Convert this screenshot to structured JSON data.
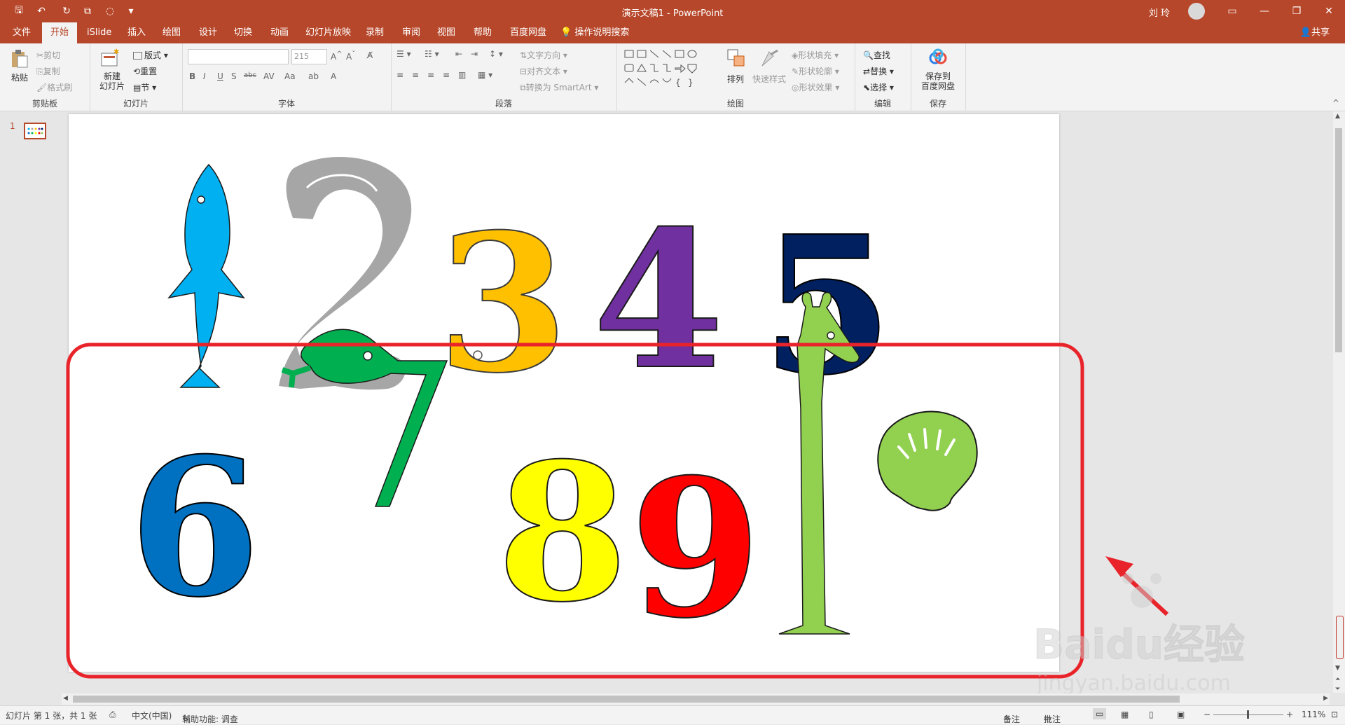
{
  "app": {
    "title": "演示文稿1  -  PowerPoint",
    "user": "刘 玲"
  },
  "tabs": [
    "文件",
    "开始",
    "iSlide",
    "插入",
    "绘图",
    "设计",
    "切换",
    "动画",
    "幻灯片放映",
    "录制",
    "审阅",
    "视图",
    "帮助",
    "百度网盘"
  ],
  "active_tab": "开始",
  "tell_me": "操作说明搜索",
  "share": "共享",
  "ribbon": {
    "clipboard": {
      "label": "剪贴板",
      "paste": "粘贴",
      "cut": "剪切",
      "copy": "复制",
      "format_painter": "格式刷"
    },
    "slides": {
      "label": "幻灯片",
      "new_slide": "新建\n幻灯片",
      "layout": "版式",
      "reset": "重置",
      "section": "节"
    },
    "font": {
      "label": "字体",
      "font_size": "215"
    },
    "paragraph": {
      "label": "段落",
      "text_direction": "文字方向",
      "align_text": "对齐文本",
      "convert_smartart": "转换为 SmartArt"
    },
    "drawing": {
      "label": "绘图",
      "arrange": "排列",
      "quick_styles": "快速样式",
      "shape_fill": "形状填充",
      "shape_outline": "形状轮廓",
      "shape_effects": "形状效果"
    },
    "editing": {
      "label": "编辑",
      "find": "查找",
      "replace": "替换",
      "select": "选择"
    },
    "save": {
      "label": "保存",
      "save_to_baidu": "保存到\n百度网盘"
    }
  },
  "thumbnails": [
    {
      "number": "1"
    }
  ],
  "slide": {
    "numbers": [
      "3",
      "4",
      "5",
      "6",
      "7",
      "8",
      "9"
    ],
    "colors": {
      "fish": "#00b0f0",
      "two": "#a6a6a6",
      "three": "#ffc000",
      "four": "#7030a0",
      "five": "#002060",
      "six": "#0070c0",
      "seven": "#00b050",
      "eight": "#ffff00",
      "nine": "#ff0000",
      "giraffe": "#92d050",
      "shell": "#92d050"
    }
  },
  "annotation": {
    "highlight_color": "#e8232a",
    "arrow_color": "#e8232a"
  },
  "watermark": {
    "brand": "Baidu经验",
    "url": "jingyan.baidu.com"
  },
  "status": {
    "slide_info": "幻灯片 第 1 张，共 1 张",
    "language": "中文(中国)",
    "accessibility": "辅助功能: 调查",
    "notes": "备注",
    "comments": "批注",
    "zoom": "111%"
  }
}
